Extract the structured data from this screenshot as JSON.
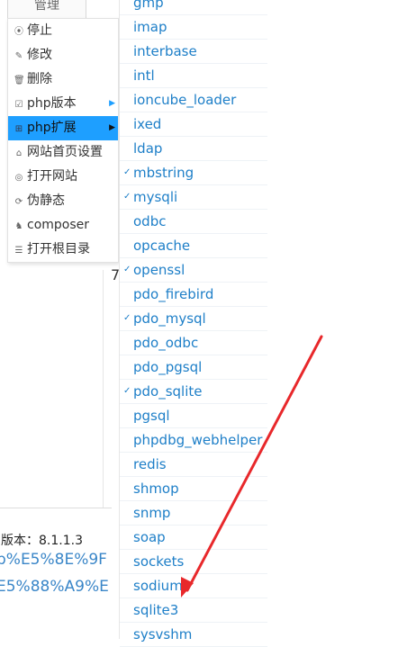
{
  "background": {
    "header_cell": "管理",
    "version_text": "版本：8.1.1.3",
    "url_line1": "p%E5%8E%9F",
    "url_line2": "E5%88%A9%E",
    "fragment": "7"
  },
  "menu": {
    "items": [
      {
        "label": "停止",
        "icon": "stop-icon",
        "glyph": "⦿"
      },
      {
        "label": "修改",
        "icon": "pencil-icon",
        "glyph": "✎"
      },
      {
        "label": "删除",
        "icon": "trash-icon",
        "glyph": "🗑"
      },
      {
        "label": "php版本",
        "icon": "checkbox-icon",
        "glyph": "☑"
      },
      {
        "label": "php扩展",
        "icon": "extension-icon",
        "glyph": "⊞"
      },
      {
        "label": "网站首页设置",
        "icon": "home-icon",
        "glyph": "⌂"
      },
      {
        "label": "打开网站",
        "icon": "globe-icon",
        "glyph": "◎"
      },
      {
        "label": "伪静态",
        "icon": "refresh-icon",
        "glyph": "⟳"
      },
      {
        "label": "composer",
        "icon": "composer-icon",
        "glyph": "♞"
      },
      {
        "label": "打开根目录",
        "icon": "list-icon",
        "glyph": "☰"
      }
    ],
    "active_index": 4,
    "submenu_arrow": "▶"
  },
  "extensions": {
    "check_glyph": "✓",
    "items": [
      {
        "name": "gmp",
        "checked": false
      },
      {
        "name": "imap",
        "checked": false
      },
      {
        "name": "interbase",
        "checked": false
      },
      {
        "name": "intl",
        "checked": false
      },
      {
        "name": "ioncube_loader",
        "checked": false
      },
      {
        "name": "ixed",
        "checked": false
      },
      {
        "name": "ldap",
        "checked": false
      },
      {
        "name": "mbstring",
        "checked": true
      },
      {
        "name": "mysqli",
        "checked": true
      },
      {
        "name": "odbc",
        "checked": false
      },
      {
        "name": "opcache",
        "checked": false
      },
      {
        "name": "openssl",
        "checked": true
      },
      {
        "name": "pdo_firebird",
        "checked": false
      },
      {
        "name": "pdo_mysql",
        "checked": true
      },
      {
        "name": "pdo_odbc",
        "checked": false
      },
      {
        "name": "pdo_pgsql",
        "checked": false
      },
      {
        "name": "pdo_sqlite",
        "checked": true
      },
      {
        "name": "pgsql",
        "checked": false
      },
      {
        "name": "phpdbg_webhelper",
        "checked": false
      },
      {
        "name": "redis",
        "checked": false
      },
      {
        "name": "shmop",
        "checked": false
      },
      {
        "name": "snmp",
        "checked": false
      },
      {
        "name": "soap",
        "checked": false
      },
      {
        "name": "sockets",
        "checked": false
      },
      {
        "name": "sodium",
        "checked": false
      },
      {
        "name": "sqlite3",
        "checked": false
      },
      {
        "name": "sysvshm",
        "checked": false
      }
    ]
  },
  "annotation": {
    "color": "#e8282b",
    "target": "sqlite3"
  }
}
